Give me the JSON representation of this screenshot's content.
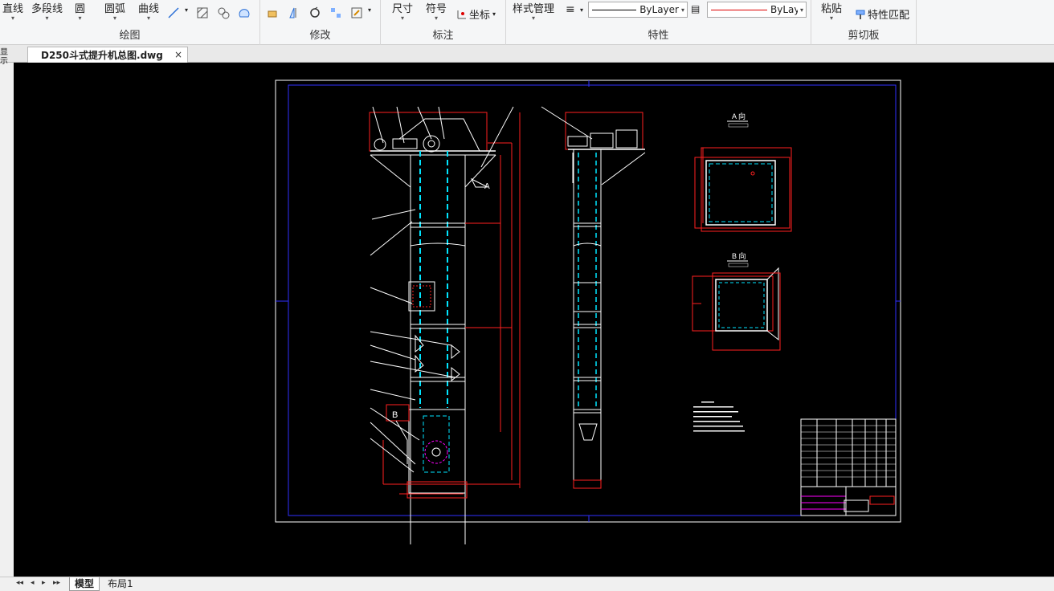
{
  "ribbon": {
    "draw_group": {
      "label": "绘图",
      "items": [
        "直线",
        "多段线",
        "圆",
        "圆弧",
        "曲线"
      ]
    },
    "modify_group": {
      "label": "修改"
    },
    "annotate_group": {
      "label": "标注",
      "items": [
        "尺寸",
        "符号",
        "坐标"
      ]
    },
    "properties_group": {
      "label": "特性",
      "style_manager": "样式管理",
      "linetype_value": "ByLayer",
      "color_value": "ByLayer"
    },
    "clipboard_group": {
      "label": "剪切板",
      "paste": "粘贴",
      "match_properties": "特性匹配"
    }
  },
  "document": {
    "tab_label": "D250斗式提升机总图.dwg",
    "close": "×"
  },
  "left_toolbar": {
    "text": "显示"
  },
  "drawing": {
    "view_a": {
      "title": "A 向"
    },
    "view_b": {
      "title": "B 向"
    },
    "label_a": "A",
    "label_b": "B"
  },
  "layout_tabs": {
    "model": "模型",
    "layout1": "布局1"
  },
  "colors": {
    "canvas": "#000000",
    "frame": "#0000ff",
    "part": "#ffffff",
    "dimension": "#ff0000",
    "chain": "#00ffff",
    "accent": "#ff00ff"
  }
}
